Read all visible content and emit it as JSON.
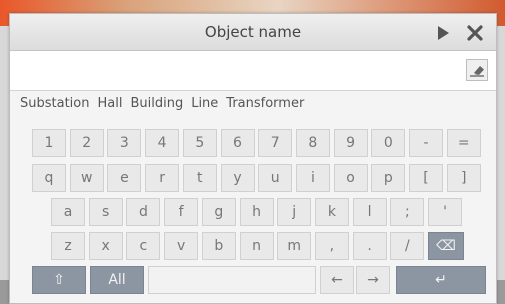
{
  "dialog": {
    "title": "Object name",
    "input_value": ""
  },
  "suggestions": [
    "Substation",
    "Hall",
    "Building",
    "Line",
    "Transformer"
  ],
  "rows": [
    [
      "1",
      "2",
      "3",
      "4",
      "5",
      "6",
      "7",
      "8",
      "9",
      "0",
      "-",
      "="
    ],
    [
      "q",
      "w",
      "e",
      "r",
      "t",
      "y",
      "u",
      "i",
      "o",
      "p",
      "[",
      "]"
    ],
    [
      "a",
      "s",
      "d",
      "f",
      "g",
      "h",
      "j",
      "k",
      "l",
      ";",
      "'"
    ],
    [
      "z",
      "x",
      "c",
      "v",
      "b",
      "n",
      "m",
      ",",
      ".",
      "/"
    ]
  ],
  "special": {
    "shift_glyph": "⇧",
    "all_label": "All",
    "left_glyph": "←",
    "right_glyph": "→",
    "enter_glyph": "↵",
    "backspace_glyph": "⌫"
  },
  "icons": {
    "play": "play-icon",
    "close": "close-icon",
    "eraser": "eraser-icon"
  },
  "colors": {
    "dark_key": "#8c96a3",
    "key": "#e9e9e9"
  }
}
